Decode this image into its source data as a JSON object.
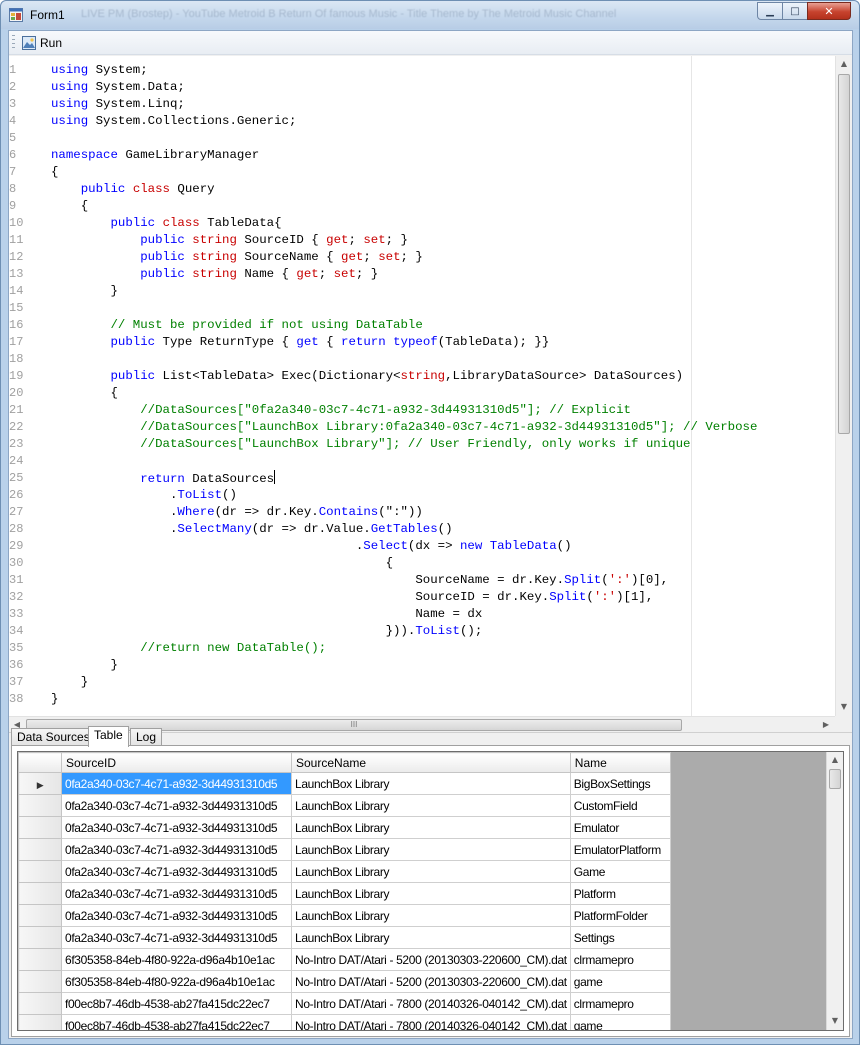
{
  "window": {
    "title": "Form1",
    "background_ghost": "LIVE PM (Brostep) - YouTube Metroid B Return Of famous Music - Title Theme by The Metroid Music Channel",
    "controls": {
      "minimize": "▁",
      "maximize": "□",
      "close": "✕"
    }
  },
  "toolbar": {
    "run_label": "Run",
    "run_icon": "run-image-icon"
  },
  "editor": {
    "lines": [
      {
        "n": "1",
        "html": "<span class='t-kw'>using</span> System;"
      },
      {
        "n": "2",
        "html": "<span class='t-kw'>using</span> System.Data;"
      },
      {
        "n": "3",
        "html": "<span class='t-kw'>using</span> System.Linq;"
      },
      {
        "n": "4",
        "html": "<span class='t-kw'>using</span> System.Collections.Generic;"
      },
      {
        "n": "5",
        "html": ""
      },
      {
        "n": "6",
        "html": "<span class='t-kw'>namespace</span> GameLibraryManager"
      },
      {
        "n": "7",
        "html": "{"
      },
      {
        "n": "8",
        "html": "    <span class='t-kw'>public</span> <span class='t-type'>class</span> Query"
      },
      {
        "n": "9",
        "html": "    {"
      },
      {
        "n": "10",
        "html": "        <span class='t-kw'>public</span> <span class='t-type'>class</span> TableData{"
      },
      {
        "n": "11",
        "html": "            <span class='t-kw'>public</span> <span class='t-type'>string</span> SourceID { <span class='t-type'>get</span>; <span class='t-type'>set</span>; }"
      },
      {
        "n": "12",
        "html": "            <span class='t-kw'>public</span> <span class='t-type'>string</span> SourceName { <span class='t-type'>get</span>; <span class='t-type'>set</span>; }"
      },
      {
        "n": "13",
        "html": "            <span class='t-kw'>public</span> <span class='t-type'>string</span> Name { <span class='t-type'>get</span>; <span class='t-type'>set</span>; }"
      },
      {
        "n": "14",
        "html": "        }"
      },
      {
        "n": "15",
        "html": ""
      },
      {
        "n": "16",
        "html": "        <span class='t-cm'>// Must be provided if not using DataTable</span>"
      },
      {
        "n": "17",
        "html": "        <span class='t-kw'>public</span> Type ReturnType { <span class='t-kw'>get</span> { <span class='t-kw'>return</span> <span class='t-kw'>typeof</span>(TableData); }}"
      },
      {
        "n": "18",
        "html": ""
      },
      {
        "n": "19",
        "html": "        <span class='t-kw'>public</span> List&lt;TableData&gt; Exec(Dictionary&lt;<span class='t-type'>string</span>,LibraryDataSource&gt; DataSources)"
      },
      {
        "n": "20",
        "html": "        {"
      },
      {
        "n": "21",
        "html": "            <span class='t-cm'>//DataSources[\"0fa2a340-03c7-4c71-a932-3d44931310d5\"]; // Explicit</span>"
      },
      {
        "n": "22",
        "html": "            <span class='t-cm'>//DataSources[\"LaunchBox Library:0fa2a340-03c7-4c71-a932-3d44931310d5\"]; // Verbose</span>"
      },
      {
        "n": "23",
        "html": "            <span class='t-cm'>//DataSources[\"LaunchBox Library\"]; // User Friendly, only works if unique</span>"
      },
      {
        "n": "24",
        "html": ""
      },
      {
        "n": "25",
        "html": "            <span class='t-kw'>return</span> DataSources<span class='caret'></span>"
      },
      {
        "n": "26",
        "html": "                .<span class='t-ref'>ToList</span>()"
      },
      {
        "n": "27",
        "html": "                .<span class='t-ref'>Where</span>(dr =&gt; dr.Key.<span class='t-ref'>Contains</span>(<span class='t-str'>\":\"</span>))"
      },
      {
        "n": "28",
        "html": "                .<span class='t-ref'>SelectMany</span>(dr =&gt; dr.Value.<span class='t-ref'>GetTables</span>()"
      },
      {
        "n": "29",
        "html": "                                         .<span class='t-ref'>Select</span>(dx =&gt; <span class='t-kw'>new</span> <span class='t-ref'>TableData</span>()"
      },
      {
        "n": "30",
        "html": "                                             {"
      },
      {
        "n": "31",
        "html": "                                                 SourceName = dr.Key.<span class='t-ref'>Split</span>(<span class='t-type'>':'</span>)[0],"
      },
      {
        "n": "32",
        "html": "                                                 SourceID = dr.Key.<span class='t-ref'>Split</span>(<span class='t-type'>':'</span>)[1],"
      },
      {
        "n": "33",
        "html": "                                                 Name = dx"
      },
      {
        "n": "34",
        "html": "                                             })).<span class='t-ref'>ToList</span>();"
      },
      {
        "n": "35",
        "html": "            <span class='t-cm'>//return new DataTable();</span>"
      },
      {
        "n": "36",
        "html": "        }"
      },
      {
        "n": "37",
        "html": "    }"
      },
      {
        "n": "38",
        "html": "}"
      }
    ],
    "hscroll_grip": "III"
  },
  "tabs": [
    {
      "label": "Data Sources",
      "active": false
    },
    {
      "label": "Table",
      "active": true
    },
    {
      "label": "Log",
      "active": false
    }
  ],
  "grid": {
    "columns": [
      "SourceID",
      "SourceName",
      "Name"
    ],
    "selected_row": 0,
    "rows": [
      [
        "0fa2a340-03c7-4c71-a932-3d44931310d5",
        "LaunchBox Library",
        "BigBoxSettings"
      ],
      [
        "0fa2a340-03c7-4c71-a932-3d44931310d5",
        "LaunchBox Library",
        "CustomField"
      ],
      [
        "0fa2a340-03c7-4c71-a932-3d44931310d5",
        "LaunchBox Library",
        "Emulator"
      ],
      [
        "0fa2a340-03c7-4c71-a932-3d44931310d5",
        "LaunchBox Library",
        "EmulatorPlatform"
      ],
      [
        "0fa2a340-03c7-4c71-a932-3d44931310d5",
        "LaunchBox Library",
        "Game"
      ],
      [
        "0fa2a340-03c7-4c71-a932-3d44931310d5",
        "LaunchBox Library",
        "Platform"
      ],
      [
        "0fa2a340-03c7-4c71-a932-3d44931310d5",
        "LaunchBox Library",
        "PlatformFolder"
      ],
      [
        "0fa2a340-03c7-4c71-a932-3d44931310d5",
        "LaunchBox Library",
        "Settings"
      ],
      [
        "6f305358-84eb-4f80-922a-d96a4b10e1ac",
        "No-Intro DAT/Atari - 5200 (20130303-220600_CM).dat",
        "clrmamepro"
      ],
      [
        "6f305358-84eb-4f80-922a-d96a4b10e1ac",
        "No-Intro DAT/Atari - 5200 (20130303-220600_CM).dat",
        "game"
      ],
      [
        "f00ec8b7-46db-4538-ab27fa415dc22ec7",
        "No-Intro DAT/Atari - 7800 (20140326-040142_CM).dat",
        "clrmamepro"
      ],
      [
        "f00ec8b7-46db-4538-ab27fa415dc22ec7",
        "No-Intro DAT/Atari - 7800 (20140326-040142_CM).dat",
        "game"
      ]
    ],
    "row_indicator": "▶"
  },
  "scroll": {
    "up": "▲",
    "down": "▼",
    "left": "◀",
    "right": "▶"
  }
}
